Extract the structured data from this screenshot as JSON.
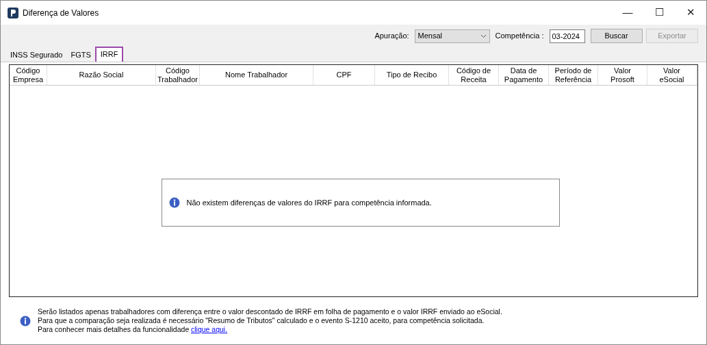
{
  "window": {
    "title": "Diferença de Valores",
    "controls": [
      "—",
      "☐",
      "✕"
    ]
  },
  "filters": {
    "apuracao_label": "Apuração:",
    "apuracao_value": "Mensal",
    "competencia_label": "Competência :",
    "competencia_value": "03-2024",
    "buttons": [
      {
        "label": "Buscar",
        "disabled": false
      },
      {
        "label": "Exportar",
        "disabled": true
      }
    ]
  },
  "tabs": [
    {
      "label": "INSS Segurado",
      "selected": false
    },
    {
      "label": "FGTS",
      "selected": false
    },
    {
      "label": "IRRF",
      "selected": true
    }
  ],
  "table": {
    "columns": [
      "Código Empresa",
      "Razão Social",
      "Código Trabalhador",
      "Nome Trabalhador",
      "CPF",
      "Tipo de Recibo",
      "Código de Receita",
      "Data de Pagamento",
      "Período de Referência",
      "Valor Prosoft",
      "Valor eSocial"
    ],
    "empty_message": "Não existem diferenças de valores do IRRF para competência informada."
  },
  "footer": {
    "lines": [
      "Serão listados apenas trabalhadores com diferença entre o valor descontado de IRRF em folha de pagamento e o valor IRRF enviado ao eSocial.",
      "Para que a comparação seja realizada é necessário \"Resumo de Tributos\" calculado e o evento S-1210 aceito, para competência solicitada.",
      "Para conhecer mais detalhes da funcionalidade"
    ],
    "link": "clique aqui."
  }
}
